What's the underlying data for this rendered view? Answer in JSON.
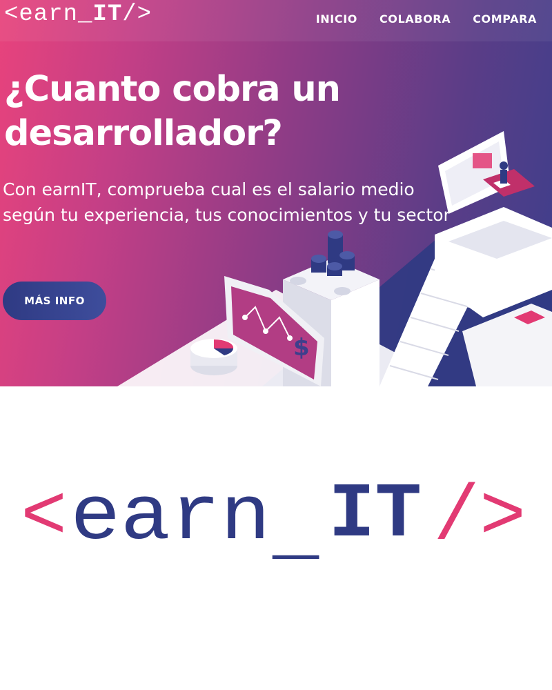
{
  "header": {
    "logo": {
      "open": "<earn_",
      "bold": "IT",
      "close": "/>"
    },
    "nav": [
      {
        "label": "INICIO"
      },
      {
        "label": "COLABORA"
      },
      {
        "label": "COMPARA"
      }
    ]
  },
  "hero": {
    "headline": "¿Cuanto cobra un desarrollador?",
    "subheadline": "Con earnIT, comprueba cual es el salario medio según tu experiencia, tus conocimientos y tu sector",
    "cta_label": "MÁS INFO"
  },
  "brand_logo": {
    "open_bracket": "<",
    "word": "earn",
    "underscore": "_",
    "bold": "IT",
    "slash": "/",
    "close_bracket": ">"
  },
  "colors": {
    "gradient_start": "#e8437c",
    "gradient_end": "#3d3f8c",
    "navy": "#2f3a83",
    "pink": "#e23a73"
  },
  "icons": [
    "dollar-sign-icon",
    "pie-chart-icon",
    "line-chart-icon"
  ]
}
